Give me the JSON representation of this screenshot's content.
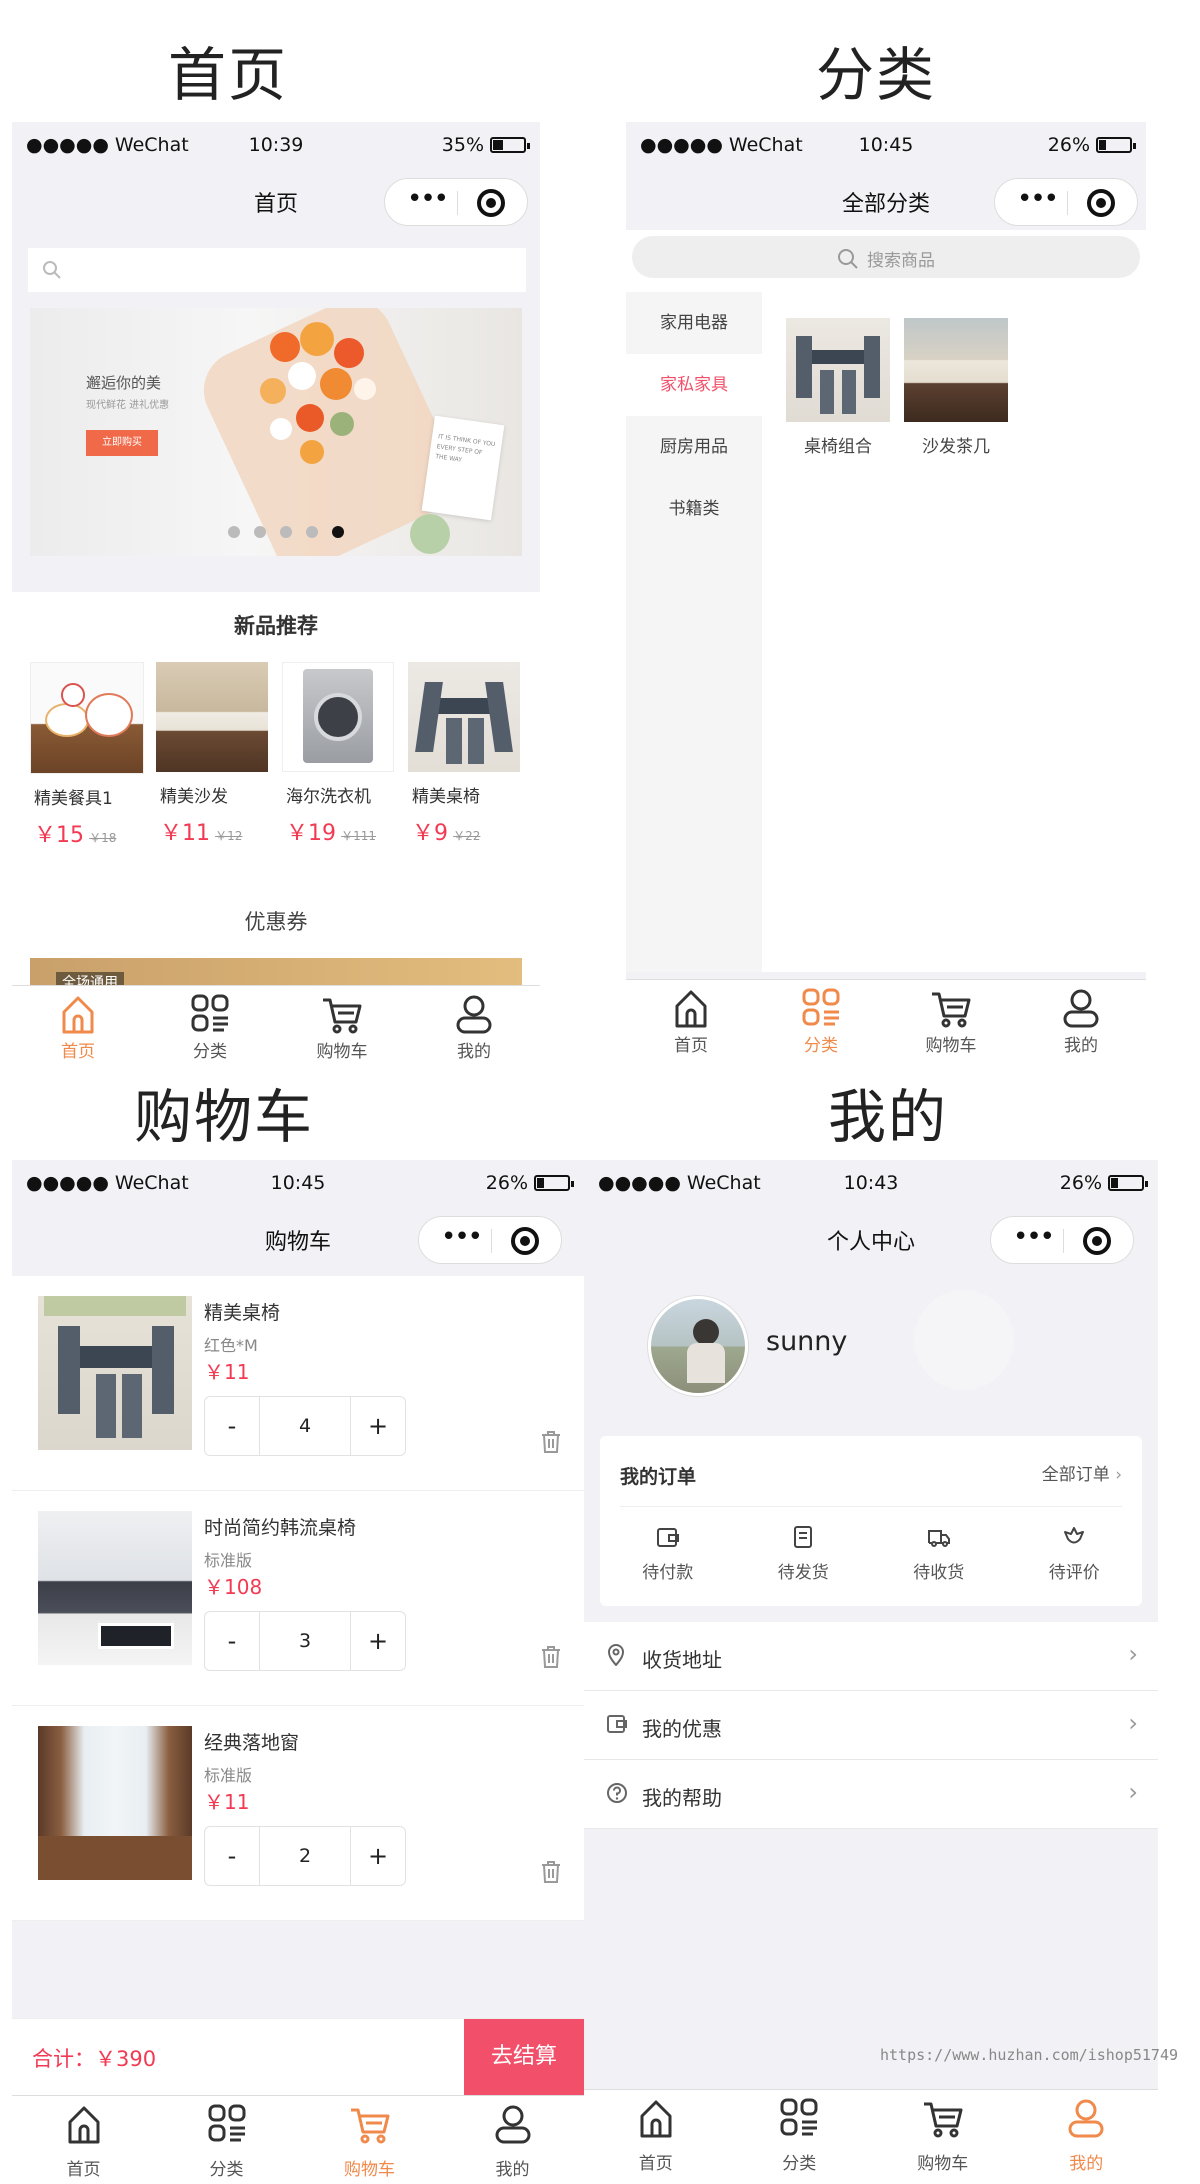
{
  "titles": {
    "home": "首页",
    "category": "分类",
    "cart": "购物车",
    "mine": "我的"
  },
  "status": {
    "home": {
      "carrier": "●●●●● WeChat",
      "time": "10:39",
      "battery": "35%",
      "battery_level": 0.35
    },
    "category": {
      "carrier": "●●●●● WeChat",
      "time": "10:45",
      "battery": "26%",
      "battery_level": 0.26
    },
    "cart": {
      "carrier": "●●●●● WeChat",
      "time": "10:45",
      "battery": "26%",
      "battery_level": 0.26
    },
    "mine": {
      "carrier": "●●●●● WeChat",
      "time": "10:43",
      "battery": "26%",
      "battery_level": 0.26
    }
  },
  "home": {
    "nav_title": "首页",
    "banner": {
      "headline": "邂逅你的美",
      "sub": "现代鲜花 进礼优惠",
      "btn": "立即购买",
      "poster": "IT IS THINK OF YOU EVERY STEP OF THE WAY"
    },
    "new_title": "新品推荐",
    "products": [
      {
        "name": "精美餐具1",
        "price": "￥15",
        "old": "￥18"
      },
      {
        "name": "精美沙发",
        "price": "￥11",
        "old": "￥12"
      },
      {
        "name": "海尔洗衣机",
        "price": "￥19",
        "old": "￥111"
      },
      {
        "name": "精美桌椅",
        "price": "￥9",
        "old": "￥22"
      }
    ],
    "coupon_title": "优惠券",
    "coupon_tag": "全场通用"
  },
  "category": {
    "nav_title": "全部分类",
    "search_placeholder": "搜索商品",
    "sidebar": [
      "家用电器",
      "家私家具",
      "厨房用品",
      "书籍类"
    ],
    "active_index": 1,
    "items": [
      {
        "name": "桌椅组合"
      },
      {
        "name": "沙发茶几"
      }
    ]
  },
  "cart": {
    "nav_title": "购物车",
    "items": [
      {
        "name": "精美桌椅",
        "spec": "红色*M",
        "price": "￥11",
        "qty": "4"
      },
      {
        "name": "时尚简约韩流桌椅",
        "spec": "标准版",
        "price": "￥108",
        "qty": "3"
      },
      {
        "name": "经典落地窗",
        "spec": "标准版",
        "price": "￥11",
        "qty": "2"
      }
    ],
    "minus": "-",
    "plus": "+",
    "total_label": "合计：",
    "total": "￥390",
    "checkout": "去结算"
  },
  "mine": {
    "nav_title": "个人中心",
    "username": "sunny",
    "orders_title": "我的订单",
    "all_orders": "全部订单",
    "order_states": [
      "待付款",
      "待发货",
      "待收货",
      "待评价"
    ],
    "menu": [
      "收货地址",
      "我的优惠",
      "我的帮助"
    ]
  },
  "tabs": [
    "首页",
    "分类",
    "购物车",
    "我的"
  ],
  "watermark": "https://www.huzhan.com/ishop51749",
  "colors": {
    "accent": "#f08a4b",
    "price": "#f23a53",
    "checkout": "#f2506a"
  }
}
